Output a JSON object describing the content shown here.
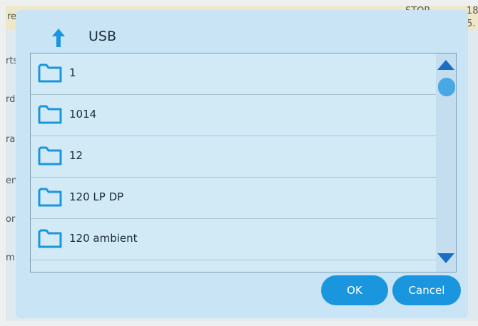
{
  "background": {
    "topbar": {
      "left_text": "re",
      "status": "STOP",
      "right_top": "18",
      "right_bottom": "5."
    },
    "side_fragments": [
      "rts",
      "rd",
      "ra",
      "en",
      "or",
      "m"
    ]
  },
  "dialog": {
    "title": "USB",
    "up_icon": "up-arrow-icon",
    "items": [
      {
        "label": "1",
        "icon": "folder-icon"
      },
      {
        "label": "1014",
        "icon": "folder-icon"
      },
      {
        "label": "12",
        "icon": "folder-icon"
      },
      {
        "label": "120 LP DP",
        "icon": "folder-icon"
      },
      {
        "label": "120 ambient",
        "icon": "folder-icon"
      }
    ],
    "ok_label": "OK",
    "cancel_label": "Cancel"
  },
  "colors": {
    "accent": "#1a96df",
    "folder_stroke": "#1a96df",
    "dialog_bg": "#c9e4f4"
  }
}
